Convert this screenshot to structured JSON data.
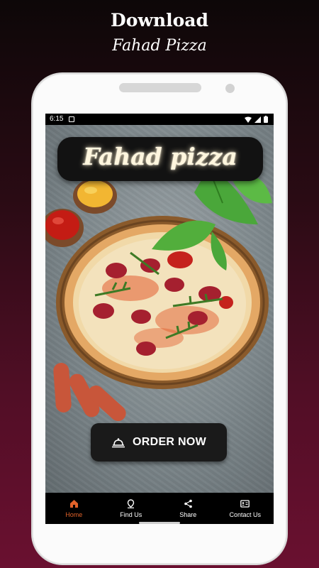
{
  "promo": {
    "headline": "Download",
    "subline": "Fahad Pizza"
  },
  "status_bar": {
    "time": "6:15",
    "icons": [
      "notification-icon",
      "wifi-icon",
      "signal-icon",
      "battery-icon"
    ]
  },
  "app": {
    "title": "Fahad pizza",
    "order_button_label": "ORDER NOW",
    "order_button_icon": "food-delivery-icon"
  },
  "bottom_nav": {
    "items": [
      {
        "label": "Home",
        "icon": "home-icon",
        "active": true
      },
      {
        "label": "Find Us",
        "icon": "location-pin-icon",
        "active": false
      },
      {
        "label": "Share",
        "icon": "share-icon",
        "active": false
      },
      {
        "label": "Contact Us",
        "icon": "contact-card-icon",
        "active": false
      }
    ],
    "active_color": "#e0622a"
  },
  "colors": {
    "background_top": "#0d0708",
    "background_bottom": "#6a1030",
    "phone_body": "#fbfbfb",
    "button_bg": "#1a1a1a"
  }
}
